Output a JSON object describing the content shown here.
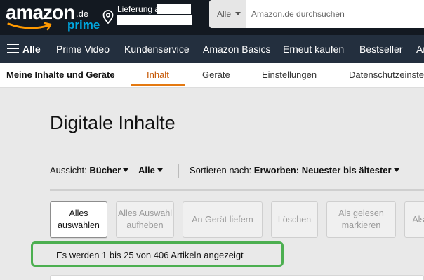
{
  "header": {
    "logo": {
      "word": "amazon",
      "tld": ".de",
      "prime": "prime"
    },
    "delivery_label": "Lieferung an",
    "search": {
      "category": "Alle",
      "placeholder": "Amazon.de durchsuchen"
    }
  },
  "nav": {
    "all_label": "Alle",
    "items": [
      "Prime Video",
      "Kundenservice",
      "Amazon Basics",
      "Erneut kaufen",
      "Bestseller",
      "Ar"
    ]
  },
  "subnav": {
    "title": "Meine Inhalte und Geräte",
    "tabs": [
      "Inhalt",
      "Geräte",
      "Einstellungen",
      "Datenschutzeinste"
    ],
    "active_tab": "Inhalt"
  },
  "main": {
    "page_title": "Digitale Inhalte",
    "filters": {
      "view_label": "Aussicht:",
      "view_value": "Bücher",
      "filter_value": "Alle",
      "sort_label": "Sortieren nach:",
      "sort_value": "Erworben: Neuester bis ältester"
    },
    "actions": [
      {
        "label": "Alles auswählen",
        "enabled": true
      },
      {
        "label": "Alles Auswahl aufheben",
        "enabled": false
      },
      {
        "label": "An Gerät liefern",
        "enabled": false
      },
      {
        "label": "Löschen",
        "enabled": false
      },
      {
        "label": "Als gelesen markieren",
        "enabled": false
      },
      {
        "label": "Als",
        "enabled": false
      }
    ],
    "result_text": "Es werden 1 bis 25 von 406 Artikeln angezeigt"
  },
  "colors": {
    "header_bg": "#131921",
    "nav_bg": "#232f3e",
    "prime_blue": "#00a8e1",
    "active_tab": "#c45500",
    "highlight": "#4caf50"
  }
}
